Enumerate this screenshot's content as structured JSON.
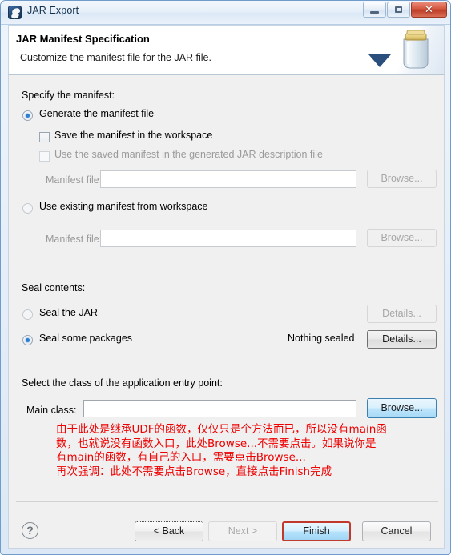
{
  "window": {
    "title": "JAR Export",
    "icon": "jar-export-icon",
    "controls": {
      "minimize": "minimize-button",
      "maximize": "maximize-button",
      "close_label": "✕"
    }
  },
  "header": {
    "title": "JAR Manifest Specification",
    "subtitle": "Customize the manifest file for the JAR file.",
    "art": "jar-illustration"
  },
  "manifest": {
    "section_label": "Specify the manifest:",
    "generate_radio": "Generate the manifest file",
    "generate_selected": true,
    "save_checkbox": "Save the manifest in the workspace",
    "save_checked": false,
    "use_saved_checkbox": "Use the saved manifest in the generated JAR description file",
    "use_saved_checked": false,
    "manifest_file_label_1": "Manifest file:",
    "manifest_file_value_1": "",
    "browse_1": "Browse...",
    "existing_radio": "Use existing manifest from workspace",
    "existing_selected": false,
    "manifest_file_label_2": "Manifest file:",
    "manifest_file_value_2": "",
    "browse_2": "Browse..."
  },
  "seal": {
    "section_label": "Seal contents:",
    "seal_jar_radio": "Seal the JAR",
    "seal_jar_selected": false,
    "details_1": "Details...",
    "seal_packages_radio": "Seal some packages",
    "seal_packages_selected": true,
    "status": "Nothing sealed",
    "details_2": "Details..."
  },
  "entry_point": {
    "section_label": "Select the class of the application entry point:",
    "main_class_label": "Main class:",
    "main_class_value": "",
    "main_class_placeholder": "",
    "browse": "Browse..."
  },
  "annotation": {
    "color": "#ee0000",
    "lines": [
      "由于此处是继承UDF的函数，仅仅只是个方法而已，所以没有main函",
      "数，也就说没有函数入口，此处Browse...不需要点击。如果说你是",
      "有main的函数，有自己的入口，需要点击Browse...",
      "再次强调：此处不需要点击Browse，直接点击Finish完成"
    ]
  },
  "footer": {
    "help": "?",
    "back": "< Back",
    "next": "Next >",
    "finish": "Finish",
    "cancel": "Cancel"
  }
}
